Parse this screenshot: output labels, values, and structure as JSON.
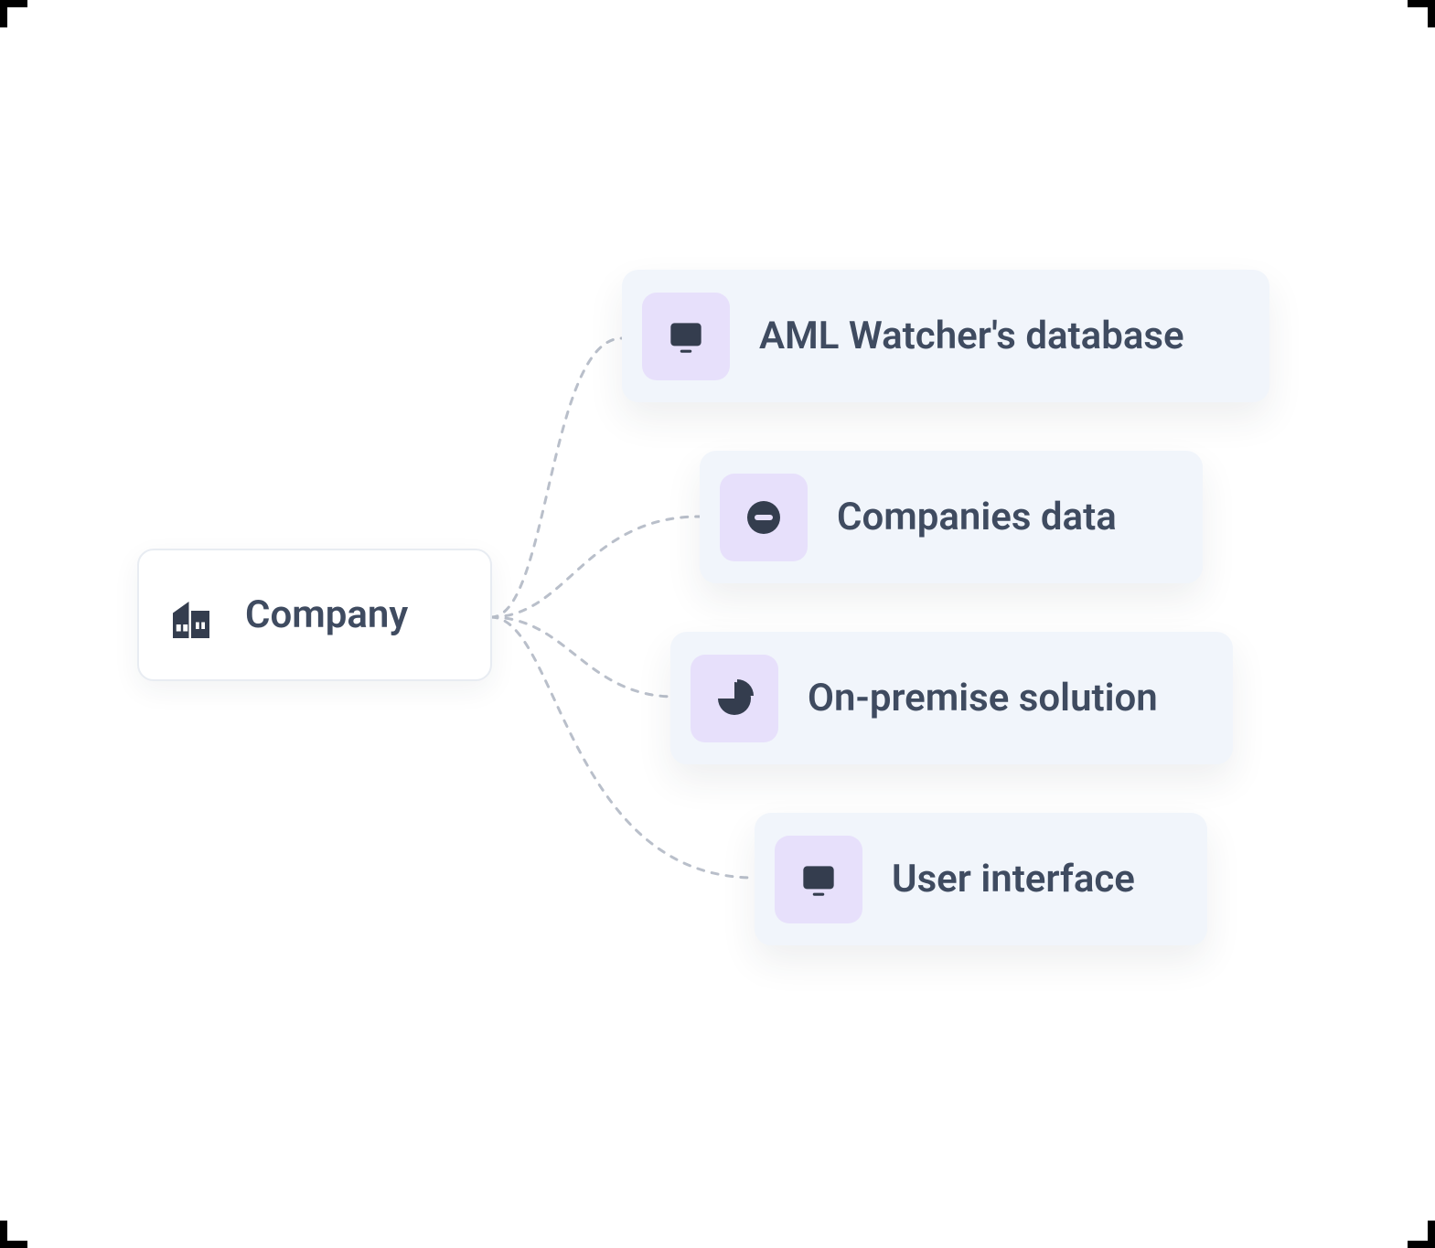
{
  "diagram": {
    "root": {
      "label": "Company",
      "icon": "building-icon"
    },
    "leaves": [
      {
        "label": "AML Watcher's database",
        "icon": "monitor-icon"
      },
      {
        "label": "Companies data",
        "icon": "minus-circle-icon"
      },
      {
        "label": "On-premise solution",
        "icon": "pie-icon"
      },
      {
        "label": "User interface",
        "icon": "monitor-icon"
      }
    ]
  },
  "colors": {
    "text": "#3f4b60",
    "iconDark": "#343d4e",
    "iconBg": "#e7e0fb",
    "leafBg": "#f1f5fb",
    "connector": "#b9bfca"
  }
}
